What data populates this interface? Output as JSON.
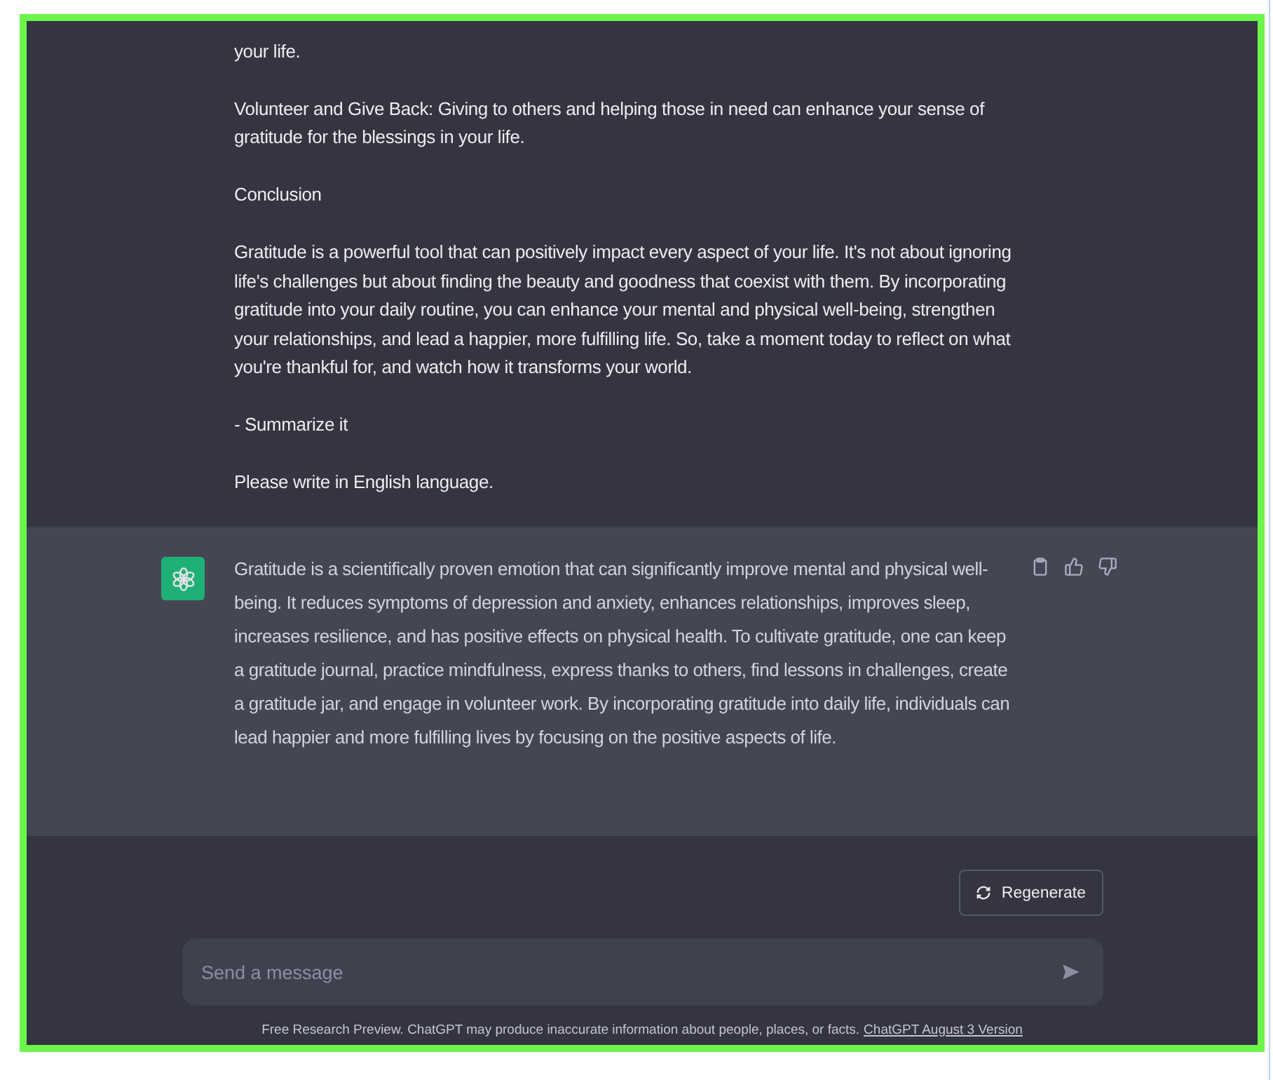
{
  "user_message": {
    "paragraphs": [
      "your life.",
      "Volunteer and Give Back: Giving to others and helping those in need can enhance your sense of gratitude for the blessings in your life.",
      "Conclusion",
      "Gratitude is a powerful tool that can positively impact every aspect of your life. It's not about ignoring life's challenges but about finding the beauty and goodness that coexist with them. By incorporating gratitude into your daily routine, you can enhance your mental and physical well-being, strengthen your relationships, and lead a happier, more fulfilling life. So, take a moment today to reflect on what you're thankful for, and watch how it transforms your world.",
      "- Summarize it",
      "Please write in English language."
    ]
  },
  "assistant_message": {
    "text": "Gratitude is a scientifically proven emotion that can significantly improve mental and physical well-being. It reduces symptoms of depression and anxiety, enhances relationships, improves sleep, increases resilience, and has positive effects on physical health. To cultivate gratitude, one can keep a gratitude journal, practice mindfulness, express thanks to others, find lessons in challenges, create a gratitude jar, and engage in volunteer work. By incorporating gratitude into daily life, individuals can lead happier and more fulfilling lives by focusing on the positive aspects of life."
  },
  "regenerate_button": "Regenerate",
  "composer": {
    "placeholder": "Send a message"
  },
  "footer": {
    "text": "Free Research Preview. ChatGPT may produce inaccurate information about people, places, or facts.",
    "link": "ChatGPT August 3 Version"
  }
}
